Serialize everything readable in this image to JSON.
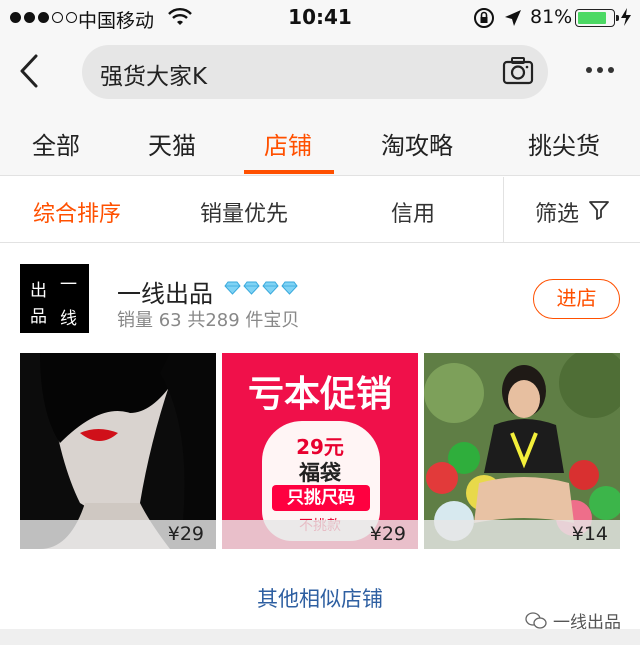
{
  "status_bar": {
    "carrier": "中国移动",
    "time": "10:41",
    "battery": "81%",
    "battery_level": 0.81,
    "icons": [
      "signal-dots",
      "wifi-icon",
      "rotation-lock-icon",
      "location-arrow-icon",
      "battery-icon",
      "charging-bolt-icon"
    ]
  },
  "search": {
    "query": "强货大家K",
    "icons": [
      "back-icon",
      "camera-icon",
      "more-icon"
    ]
  },
  "tabs": [
    {
      "label": "全部"
    },
    {
      "label": "天猫"
    },
    {
      "label": "店铺"
    },
    {
      "label": "淘攻略"
    },
    {
      "label": "挑尖货"
    }
  ],
  "active_tab": "店铺",
  "sort": {
    "options": [
      {
        "label": "综合排序"
      },
      {
        "label": "销量优先"
      },
      {
        "label": "信用"
      }
    ],
    "filter_label": "筛选",
    "active_option": "综合排序"
  },
  "shop": {
    "logo_text": [
      "出",
      "一",
      "品",
      "线"
    ],
    "name": "一线出品",
    "diamond_count": 4,
    "stats": "销量 63  共289 件宝贝",
    "enter_label": "进店",
    "products": [
      {
        "price": "¥29"
      },
      {
        "price": "¥29",
        "promo_title": "亏本促销",
        "bag_price": "29元",
        "bag_name": "福袋",
        "bag_tag": "只挑尺码",
        "bag_note": "不挑款"
      },
      {
        "price": "¥14"
      }
    ]
  },
  "similar_link": "其他相似店铺",
  "watermark": "一线出品",
  "colors": {
    "accent": "#ff5000",
    "link": "#2e5fa1",
    "battery": "#4cd964"
  }
}
